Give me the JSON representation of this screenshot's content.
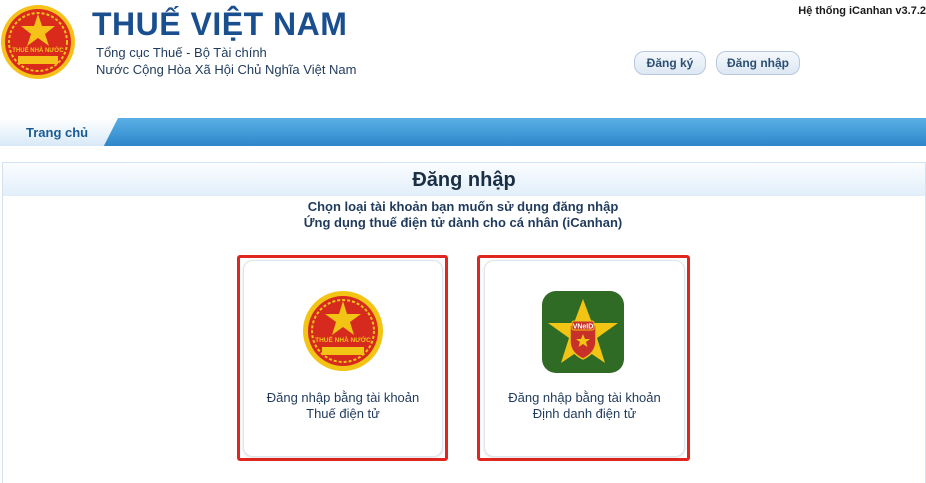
{
  "header": {
    "brand": "THUẾ VIỆT NAM",
    "subtitle1": "Tổng cục Thuế - Bộ Tài chính",
    "subtitle2": "Nước Cộng Hòa Xã Hội Chủ Nghĩa Việt Nam",
    "system": "Hệ thống iCanhan v3.7.2",
    "register": "Đăng ký",
    "login": "Đăng nhập",
    "logo_text": "THUẾ NHÀ NƯỚC"
  },
  "nav": {
    "home": "Trang chủ"
  },
  "main": {
    "title": "Đăng nhập",
    "instruction1": "Chọn loại tài khoản bạn muốn sử dụng đăng nhập",
    "instruction2": "Ứng dụng thuế điện tử dành cho cá nhân (iCanhan)",
    "cards": [
      {
        "line1": "Đăng nhập bằng tài khoản",
        "line2": "Thuế điện tử",
        "icon": "tax-emblem-icon",
        "emblem_text": "THUẾ NHÀ NƯỚC"
      },
      {
        "line1": "Đăng nhập bằng tài khoản",
        "line2": "Định danh điện tử",
        "icon": "vneid-icon",
        "emblem_text": "VNeID"
      }
    ]
  },
  "colors": {
    "brand": "#1a4f8f",
    "nav": "#2d86c9",
    "highlight": "#e0261f",
    "emblem_red": "#d62a1e",
    "emblem_gold": "#f2c414"
  }
}
